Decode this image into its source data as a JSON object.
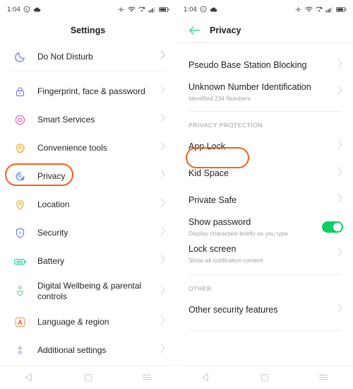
{
  "status_bar": {
    "time": "1:04",
    "left_icons": [
      "whatsapp-icon",
      "cloud-icon"
    ],
    "right_icons": [
      "nfc-icon",
      "wifi-icon",
      "vpn-icon",
      "signal-icon",
      "battery-icon"
    ]
  },
  "accent": {
    "highlight": "#F4601A",
    "toggle_on": "#0ACF63",
    "back_arrow": "#3DDC97"
  },
  "left_screen": {
    "title": "Settings",
    "items": [
      {
        "label": "Do Not Disturb",
        "icon": "moon-icon",
        "icon_color": "#7B83EB",
        "highlighted": false
      },
      {
        "label": "Fingerprint, face & password",
        "icon": "lock-icon",
        "icon_color": "#7B83EB",
        "highlighted": false
      },
      {
        "label": "Smart Services",
        "icon": "smart-services-icon",
        "icon_color": "#F061B4",
        "highlighted": false
      },
      {
        "label": "Convenience tools",
        "icon": "convenience-tools-icon",
        "icon_color": "#F5A623",
        "highlighted": false
      },
      {
        "label": "Privacy",
        "icon": "privacy-icon",
        "icon_color": "#5B8DEF",
        "highlighted": true
      },
      {
        "label": "Location",
        "icon": "location-pin-icon",
        "icon_color": "#F5A623",
        "highlighted": false
      },
      {
        "label": "Security",
        "icon": "shield-icon",
        "icon_color": "#6C7BE8",
        "highlighted": false
      },
      {
        "label": "Battery",
        "icon": "battery-icon",
        "icon_color": "#2FD3A5",
        "highlighted": false
      },
      {
        "label": "Digital Wellbeing & parental controls",
        "icon": "wellbeing-icon",
        "icon_color": "#7FCE8E",
        "highlighted": false
      },
      {
        "label": "Language & region",
        "icon": "language-icon",
        "icon_color": "#F07A3C",
        "highlighted": false
      },
      {
        "label": "Additional settings",
        "icon": "additional-settings-icon",
        "icon_color": "#8FA6E8",
        "highlighted": false
      }
    ]
  },
  "right_screen": {
    "title": "Privacy",
    "back_label": "back-arrow-icon",
    "items_top": [
      {
        "label": "Pseudo Base Station Blocking",
        "sub": ""
      },
      {
        "label": "Unknown Number Identification",
        "sub": "Identified 234 Numbers"
      }
    ],
    "section_privacy_protection": "PRIVACY PROTECTION",
    "items_privacy": [
      {
        "label": "App Lock",
        "sub": "",
        "highlighted": true,
        "control": "chevron"
      },
      {
        "label": "Kid Space",
        "sub": "",
        "highlighted": false,
        "control": "chevron"
      },
      {
        "label": "Private Safe",
        "sub": "",
        "highlighted": false,
        "control": "chevron"
      },
      {
        "label": "Show password",
        "sub": "Display characters briefly as you type",
        "highlighted": false,
        "control": "toggle",
        "toggle_on": true
      },
      {
        "label": "Lock screen",
        "sub": "Show all notification content",
        "highlighted": false,
        "control": "chevron"
      }
    ],
    "section_other": "OTHER",
    "items_other": [
      {
        "label": "Other security features",
        "sub": ""
      }
    ]
  },
  "nav_bar": {
    "buttons": [
      "back-triangle-icon",
      "home-square-icon",
      "recents-menu-icon"
    ]
  }
}
